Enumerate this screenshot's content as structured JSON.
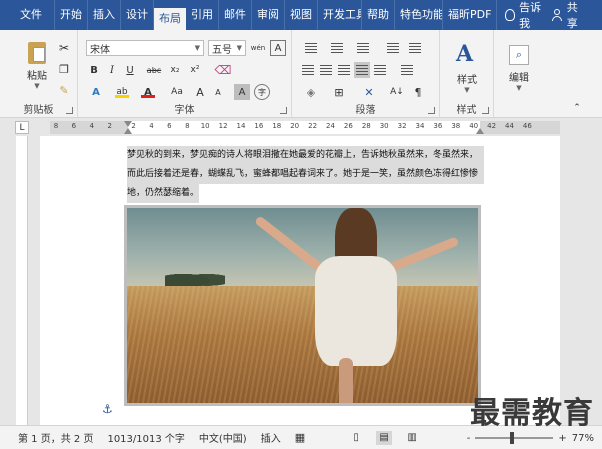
{
  "menu": {
    "tabs": [
      "文件",
      "开始",
      "插入",
      "设计",
      "布局",
      "引用",
      "邮件",
      "审阅",
      "视图",
      "开发工具",
      "帮助",
      "特色功能",
      "福昕PDF"
    ],
    "active_tab": "布局",
    "tell_me": "告诉我",
    "share": "共享"
  },
  "ribbon": {
    "clipboard": {
      "label": "剪贴板",
      "paste": "粘贴"
    },
    "font": {
      "label": "字体",
      "font_name": "宋体",
      "font_size": "五号",
      "phonetic": "wén",
      "border_char": "A",
      "bold": "B",
      "italic": "I",
      "underline": "U",
      "strike": "abc",
      "subscript": "x₂",
      "superscript": "x²",
      "text_effects": "A",
      "highlight": "ab",
      "font_color": "A",
      "change_case": "Aa",
      "grow": "A",
      "shrink": "A",
      "shading": "A",
      "enclose": "字"
    },
    "paragraph": {
      "label": "段落"
    },
    "styles": {
      "label": "样式",
      "button": "样式"
    },
    "editing": {
      "button": "编辑"
    },
    "highlight_color": "#f5d400",
    "font_color_value": "#e02020"
  },
  "ruler": {
    "corner": "L",
    "ticks": [
      "8",
      "6",
      "4",
      "2",
      "2",
      "4",
      "6",
      "8",
      "10",
      "12",
      "14",
      "16",
      "18",
      "20",
      "22",
      "24",
      "26",
      "28",
      "30",
      "32",
      "34",
      "36",
      "38",
      "40",
      "42",
      "44",
      "46"
    ]
  },
  "document": {
    "lines": [
      "梦见秋的到来，梦见痴的诗人将眼泪撒在她最爱的花瓣上，告诉她秋虽然来，冬虽然来，",
      "而此后接着还是春，蝴蝶乱飞，蜜蜂都唱起春词来了。她于是一笑，虽然颜色冻得红惨惨",
      "地，仍然瑟缩着。"
    ]
  },
  "status": {
    "page": "第 1 页，共 2 页",
    "words": "1013/1013 个字",
    "language": "中文(中国)",
    "insert": "插入",
    "zoom_minus": "-",
    "zoom_plus": "+",
    "zoom": "77%",
    "zoom_fraction": 0.45
  },
  "watermark": "最需教育"
}
